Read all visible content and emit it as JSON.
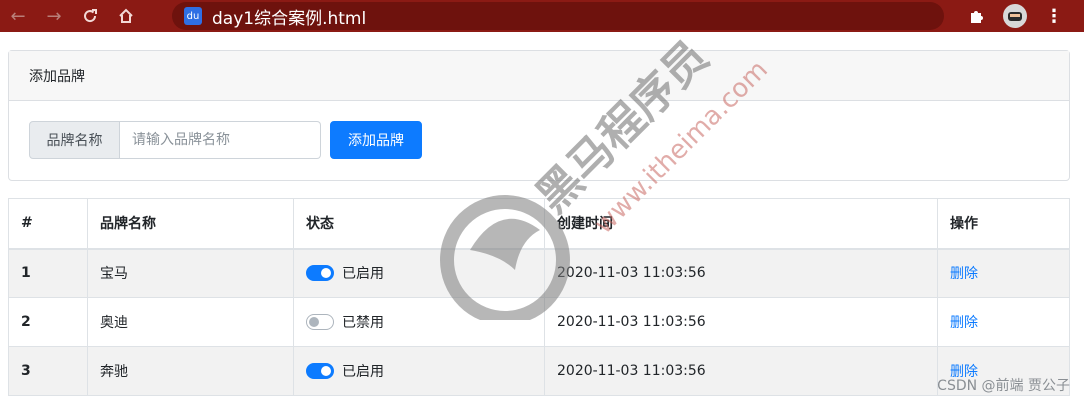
{
  "browser": {
    "url": "day1综合案例.html",
    "back_icon": "back-arrow-icon",
    "forward_icon": "forward-arrow-icon",
    "reload_icon": "reload-icon",
    "home_icon": "home-icon",
    "extensions_icon": "puzzle-icon",
    "menu_icon": "kebab-menu-icon"
  },
  "add_card": {
    "header": "添加品牌",
    "addon_label": "品牌名称",
    "input_value": "",
    "input_placeholder": "请输入品牌名称",
    "button_label": "添加品牌"
  },
  "table": {
    "headers": [
      "#",
      "品牌名称",
      "状态",
      "创建时间",
      "操作"
    ],
    "rows": [
      {
        "id": "1",
        "name": "宝马",
        "status_on": true,
        "status": "已启用",
        "time": "2020-11-03 11:03:56",
        "action": "删除"
      },
      {
        "id": "2",
        "name": "奥迪",
        "status_on": false,
        "status": "已禁用",
        "time": "2020-11-03 11:03:56",
        "action": "删除"
      },
      {
        "id": "3",
        "name": "奔驰",
        "status_on": true,
        "status": "已启用",
        "time": "2020-11-03 11:03:56",
        "action": "删除"
      }
    ]
  },
  "watermark": {
    "brand": "黑马程序员",
    "site": "www.itheima.com"
  },
  "footer_credit": "CSDN @前端 贾公子",
  "colors": {
    "browser_bar": "#8b1a14",
    "primary": "#0d7bff",
    "watermark": "#c96a64"
  }
}
